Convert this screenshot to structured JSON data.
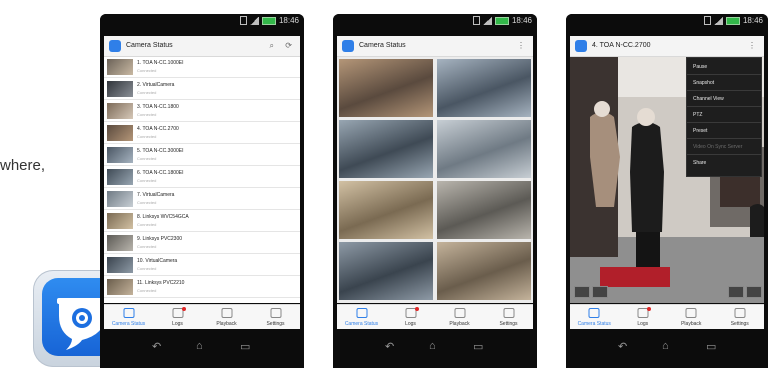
{
  "side_text": "where,",
  "colors": {
    "accent": "#2f7fe8",
    "badge": "#e02828",
    "battery": "#33b84a"
  },
  "phones": [
    {
      "status_time": "18:46",
      "appbar_title": "Camera Status",
      "appbar_icons": [
        "search-icon",
        "refresh-icon"
      ],
      "cameras": [
        {
          "name": "1. TOA N-CC.1000EI",
          "sub": "Connected"
        },
        {
          "name": "2. VirtualCamera",
          "sub": "Connected"
        },
        {
          "name": "3. TOA N-CC.1800",
          "sub": "Connected"
        },
        {
          "name": "4. TOA N-CC.2700",
          "sub": "Connected"
        },
        {
          "name": "5. TOA N-CC.3000EI",
          "sub": "Connected"
        },
        {
          "name": "6. TOA N-CC.1800EI",
          "sub": "Connected"
        },
        {
          "name": "7. VirtualCamera",
          "sub": "Connected"
        },
        {
          "name": "8. Linksys WVC54GCA",
          "sub": "Connected"
        },
        {
          "name": "9. Linksys PVC2300",
          "sub": "Connected"
        },
        {
          "name": "10. VirtualCamera",
          "sub": "Connected"
        },
        {
          "name": "11. Linksys PVC2210",
          "sub": "Connected"
        }
      ],
      "tabs": [
        "Camera Status",
        "Logs",
        "Playback",
        "Settings"
      ]
    },
    {
      "status_time": "18:46",
      "appbar_title": "Camera Status",
      "tabs": [
        "Camera Status",
        "Logs",
        "Playback",
        "Settings"
      ]
    },
    {
      "status_time": "18:46",
      "appbar_title": "4. TOA N-CC.2700",
      "menu": [
        "Pause",
        "Snapshot",
        "Channel View",
        "PTZ",
        "Preset",
        "Video On Sync Server",
        "Share"
      ],
      "tabs": [
        "Camera Status",
        "Logs",
        "Playback",
        "Settings"
      ]
    }
  ]
}
